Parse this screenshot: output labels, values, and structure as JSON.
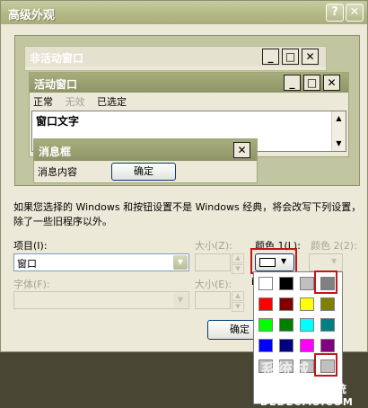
{
  "window": {
    "title": "高级外观",
    "help": "?",
    "close": "✕"
  },
  "preview": {
    "inactive_title": "非活动窗口",
    "active_title": "活动窗口",
    "menu": [
      "正常",
      "无效",
      "已选定"
    ],
    "window_text": "窗口文字",
    "msgbox": {
      "title": "消息框",
      "content": "消息内容",
      "ok": "确定"
    },
    "min": "_",
    "max": "□",
    "close": "✕"
  },
  "description": "如果您选择的 Windows 和按钮设置不是 Windows 经典，将会改写下列设置，除了一些旧程序以外。",
  "item": {
    "label": "项目(I):",
    "value": "窗口",
    "size_label": "大小(Z):",
    "color1_label": "颜色 1(L):",
    "color2_label": "颜色 2(2):"
  },
  "font": {
    "label": "字体(F):",
    "size_label": "大小(E):",
    "fragment": "i"
  },
  "ok_button": "确定",
  "palette_colors": [
    [
      "#ffffff",
      "#000000",
      "#c0c0c0",
      "#808080"
    ],
    [
      "#ff0000",
      "#800000",
      "#ffff00",
      "#808000"
    ],
    [
      "#00ff00",
      "#008000",
      "#00ffff",
      "#008080"
    ],
    [
      "#0000ff",
      "#000080",
      "#ff00ff",
      "#800080"
    ],
    [
      "#c0c0c0",
      "#c0c0c0",
      "#c0c0c0",
      "#c0c0c0"
    ]
  ],
  "watermark": {
    "line1": "系统城",
    "line2": "织梦内容管理系统",
    "line3": "DEDECMS.COM"
  },
  "colors": {
    "accent_red": "#c41616",
    "title_olive": "#a7ad7b"
  }
}
